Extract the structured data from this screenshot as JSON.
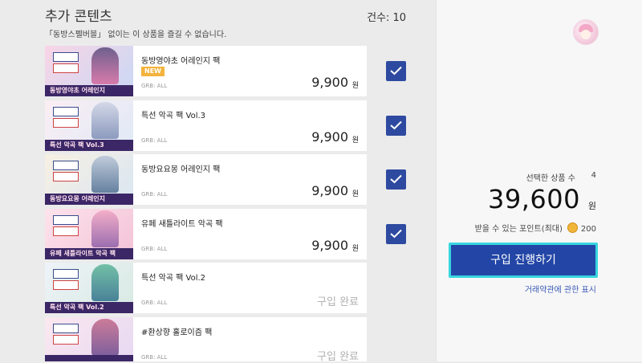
{
  "header": {
    "title": "추가 콘텐츠",
    "count_label": "건수:",
    "count_value": "10",
    "subtitle": "「동방스펠버블」 없이는 이 상품을 즐길 수 없습니다."
  },
  "colors": {
    "checkbox": "#2e4aa0",
    "buy_button": "#2346a6",
    "buy_focus": "#37d6e0",
    "new_badge": "#f3b33d"
  },
  "items": [
    {
      "name": "동방영야초 어레인지 팩",
      "badge": "NEW",
      "rating": "GRB: ALL",
      "price": "9,900",
      "currency": "원",
      "status": "",
      "checked": true,
      "thumb_caption": "동방영야초 어레인지"
    },
    {
      "name": "특선 악곡 팩 Vol.3",
      "badge": "",
      "rating": "GRB: ALL",
      "price": "9,900",
      "currency": "원",
      "status": "",
      "checked": true,
      "thumb_caption": "특선 악곡 팩 Vol.3"
    },
    {
      "name": "동방요요몽 어레인지 팩",
      "badge": "",
      "rating": "GRB: ALL",
      "price": "9,900",
      "currency": "원",
      "status": "",
      "checked": true,
      "thumb_caption": "동방요요몽 어레인지"
    },
    {
      "name": "유페 새틀라이트 악곡 팩",
      "badge": "",
      "rating": "GRB: ALL",
      "price": "9,900",
      "currency": "원",
      "status": "",
      "checked": true,
      "thumb_caption": "유페 새틀라이트 악곡 팩"
    },
    {
      "name": "특선 악곡 팩 Vol.2",
      "badge": "",
      "rating": "GRB: ALL",
      "price": "",
      "currency": "",
      "status": "구입 완료",
      "checked": false,
      "thumb_caption": "특선 악곡 팩 Vol.2"
    },
    {
      "name": "#환상향 홀로이즘 팩",
      "badge": "",
      "rating": "GRB: ALL",
      "price": "",
      "currency": "",
      "status": "구입 완료",
      "checked": false,
      "thumb_caption": "#환상향 홀로이즘"
    }
  ],
  "summary": {
    "selected_label": "선택한 상품 수",
    "selected_count": "4",
    "total": "39,600",
    "currency": "원",
    "points_label": "받을 수 있는 포인트(최대)",
    "points_value": "200",
    "buy_label": "구입 진행하기",
    "terms_link": "거래약관에 관한 표시"
  }
}
